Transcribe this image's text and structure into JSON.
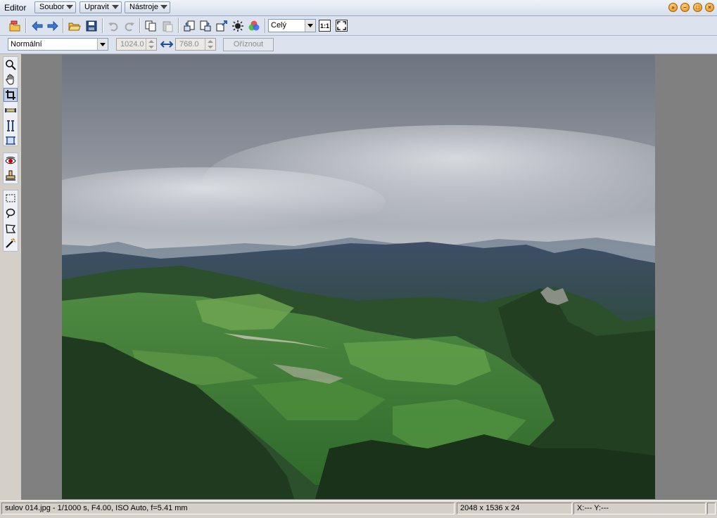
{
  "app": {
    "title": "Editor"
  },
  "menu": {
    "items": [
      {
        "label": "Soubor"
      },
      {
        "label": "Upravit"
      },
      {
        "label": "Nástroje"
      }
    ]
  },
  "toolbar": {
    "zoom": {
      "value": "Celý"
    },
    "actual_size_label": "1:1"
  },
  "options": {
    "mode": {
      "value": "Normální"
    },
    "width": {
      "value": "1024.0"
    },
    "height": {
      "value": "768.0"
    },
    "crop_label": "Oříznout"
  },
  "statusbar": {
    "file_info": "sulov 014.jpg - 1/1000 s, F4.00, ISO Auto, f=5.41 mm",
    "dimensions": "2048 x 1536 x 24",
    "coords": "X:---  Y:---"
  },
  "colors": {
    "canvas_bg": "#818081",
    "ui_bg": "#d4d0c8",
    "accent": "#e78a12"
  }
}
